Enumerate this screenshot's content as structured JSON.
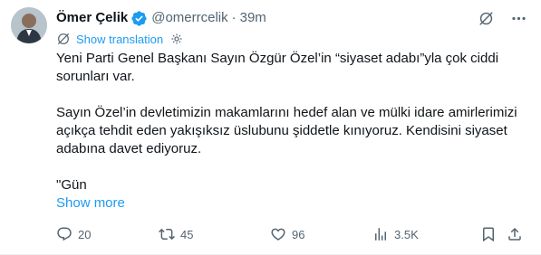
{
  "author": {
    "name": "Ömer Çelik",
    "handle": "@omerrcelik",
    "separator": "·",
    "time": "39m"
  },
  "translate": {
    "label": "Show translation"
  },
  "tweet": {
    "paragraph1": "Yeni Parti Genel Başkanı Sayın Özgür Özel’in “siyaset adabı”yla çok ciddi sorunları var.",
    "paragraph2": "Sayın Özel’in devletimizin makamlarını hedef alan ve mülki idare amirlerimizi açıkça tehdit eden yakışıksız üslubunu şiddetle kınıyoruz. Kendisini siyaset adabına davet ediyoruz.",
    "paragraph3": "\"Gün",
    "show_more": "Show more"
  },
  "actions": {
    "replies": "20",
    "retweets": "45",
    "likes": "96",
    "views": "3.5K"
  },
  "colors": {
    "accent": "#1d9bf0",
    "muted": "#536471",
    "text": "#0f1419"
  },
  "icons": {
    "verified": "verified-badge-icon",
    "grok": "grok-icon",
    "more": "more-icon",
    "translate": "translate-icon",
    "settings": "gear-icon",
    "reply": "reply-icon",
    "retweet": "retweet-icon",
    "like": "heart-icon",
    "views": "views-icon",
    "bookmark": "bookmark-icon",
    "share": "share-icon"
  }
}
